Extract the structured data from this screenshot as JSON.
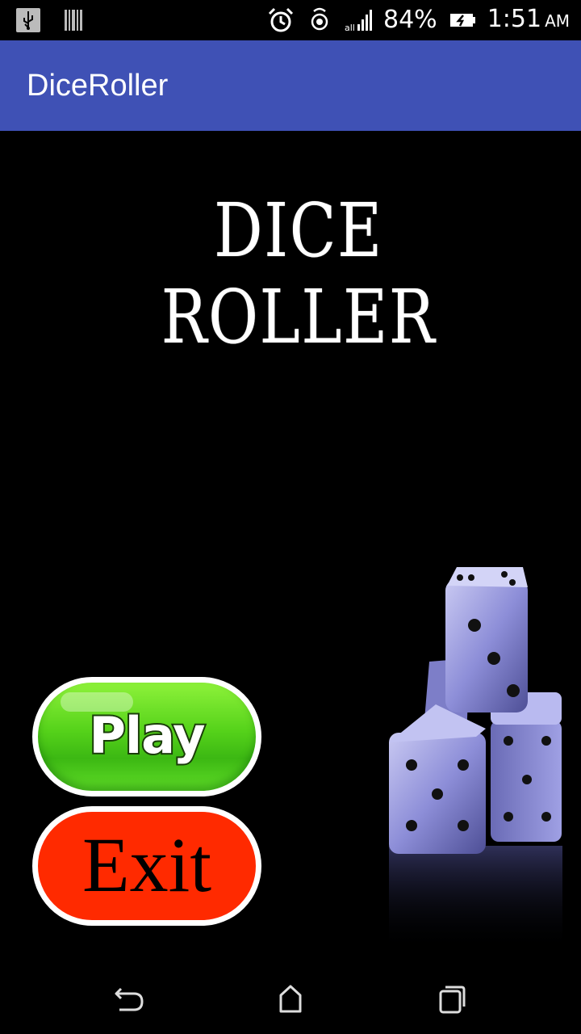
{
  "status_bar": {
    "icons_left": [
      "usb-icon",
      "barcode-icon"
    ],
    "icons_right": [
      "alarm-icon",
      "hotspot-icon",
      "signal-icon",
      "battery-icon"
    ],
    "battery": "84%",
    "time": "1:51",
    "ampm": "AM"
  },
  "app_bar": {
    "title": "DiceRoller",
    "color": "#3F51B5"
  },
  "main": {
    "logo_text": "DICE ROLLER",
    "play_label": "Play",
    "exit_label": "Exit",
    "play_color": "#55d21a",
    "exit_color": "#ff2a00",
    "dice_image": "dice-stack-icon"
  },
  "nav_bar": {
    "items": [
      "back-icon",
      "home-icon",
      "recents-icon"
    ]
  }
}
